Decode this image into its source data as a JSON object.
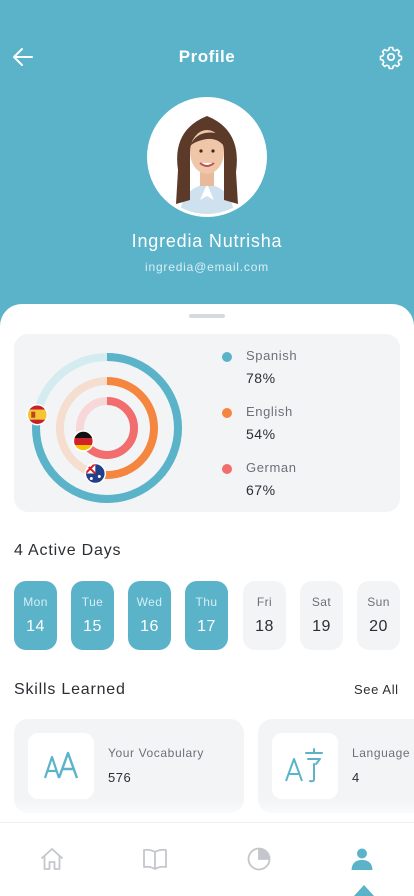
{
  "header": {
    "title": "Profile",
    "back_icon": "arrow-left-icon",
    "settings_icon": "gear-icon"
  },
  "user": {
    "name": "Ingredia Nutrisha",
    "email": "ingredia@email.com"
  },
  "languages": [
    {
      "name": "Spanish",
      "percent_label": "78%",
      "percent": 78,
      "color": "#5ab3c9",
      "flag": "spain-flag-icon"
    },
    {
      "name": "English",
      "percent_label": "54%",
      "percent": 54,
      "color": "#f5863f",
      "flag": "australia-flag-icon"
    },
    {
      "name": "German",
      "percent_label": "67%",
      "percent": 67,
      "color": "#f26d6d",
      "flag": "germany-flag-icon"
    }
  ],
  "active_days": {
    "title": "4 Active Days",
    "days": [
      {
        "name": "Mon",
        "num": "14",
        "active": true
      },
      {
        "name": "Tue",
        "num": "15",
        "active": true
      },
      {
        "name": "Wed",
        "num": "16",
        "active": true
      },
      {
        "name": "Thu",
        "num": "17",
        "active": true
      },
      {
        "name": "Fri",
        "num": "18",
        "active": false
      },
      {
        "name": "Sat",
        "num": "19",
        "active": false
      },
      {
        "name": "Sun",
        "num": "20",
        "active": false
      }
    ]
  },
  "skills": {
    "title": "Skills Learned",
    "see_all": "See All",
    "items": [
      {
        "label": "Your Vocabulary",
        "count": "576",
        "icon": "font-size-icon"
      },
      {
        "label": "Language",
        "count": "4",
        "icon": "translate-icon"
      }
    ]
  },
  "tabbar": {
    "tabs": [
      {
        "icon": "home-icon",
        "active": false
      },
      {
        "icon": "book-icon",
        "active": false
      },
      {
        "icon": "pie-chart-icon",
        "active": false
      },
      {
        "icon": "user-icon",
        "active": true
      }
    ]
  },
  "colors": {
    "primary": "#5ab3c9",
    "orange": "#f5863f",
    "coral": "#f26d6d",
    "card_bg": "#f3f4f6"
  }
}
